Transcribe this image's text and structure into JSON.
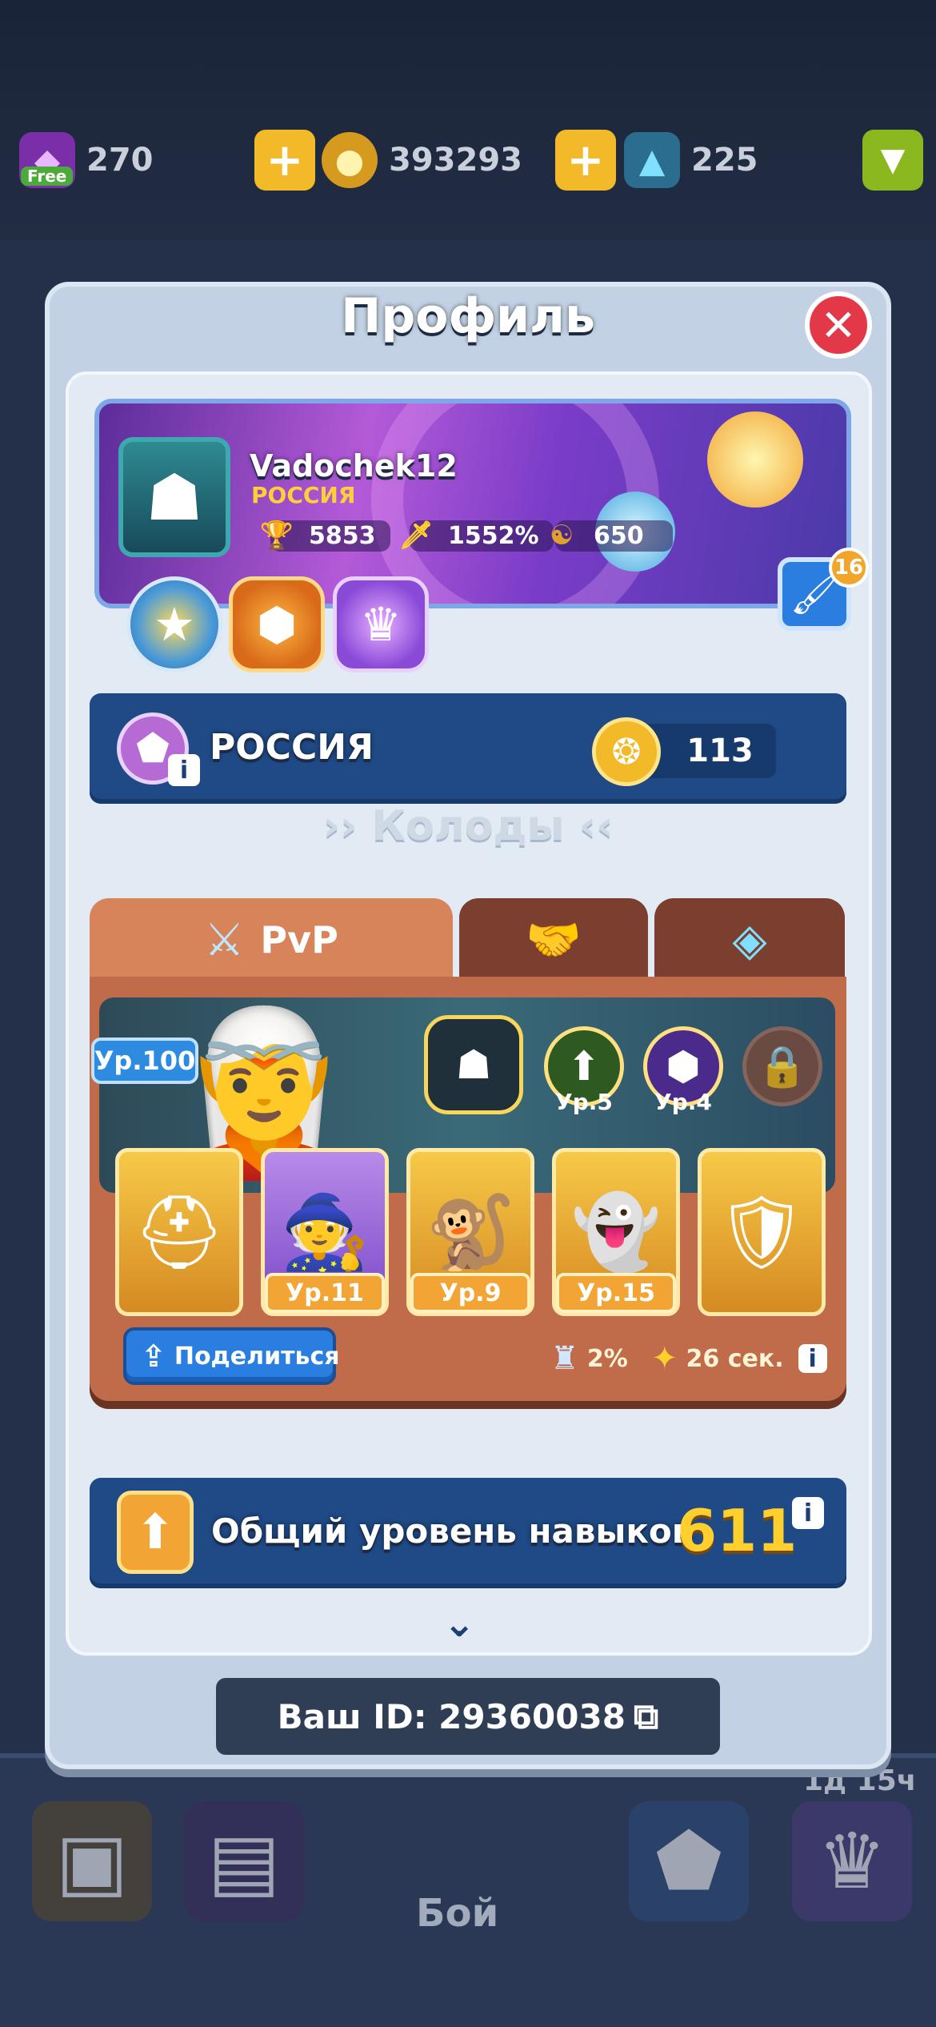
{
  "resources": {
    "gems": "270",
    "gems_tag": "Free",
    "coins": "393293",
    "crystals": "225"
  },
  "modal": {
    "title": "Профиль",
    "close_icon": "close-icon"
  },
  "player": {
    "name": "Vadochek12",
    "country": "РОССИЯ",
    "trophies": "5853",
    "crit": "1552%",
    "karma": "650",
    "customize_badge": "16"
  },
  "clan": {
    "name": "РОССИЯ",
    "score": "113"
  },
  "decks": {
    "title": "Колоды",
    "tabs": [
      {
        "label": "PvP",
        "icon": "swords-icon"
      },
      {
        "label": "",
        "icon": "handshake-icon"
      },
      {
        "label": "",
        "icon": "crystal-icon"
      }
    ],
    "hero_level": "Ур.100",
    "talents": [
      {
        "level": "Ур.5"
      },
      {
        "level": "Ур.4"
      }
    ],
    "cards": [
      {
        "name": "knight-card",
        "level": ""
      },
      {
        "name": "witch-card",
        "level": "Ур.11"
      },
      {
        "name": "monkey-card",
        "level": "Ур.9"
      },
      {
        "name": "spirit-card",
        "level": "Ур.15"
      },
      {
        "name": "paladin-card",
        "level": ""
      }
    ],
    "share_label": "Поделиться",
    "winrate": "2%",
    "time": "26 сек."
  },
  "skills": {
    "label": "Общий уровень навыков",
    "value": "611"
  },
  "player_id": {
    "label": "Ваш ID: 29360038"
  },
  "bottom_nav": {
    "battle_label": "Бой",
    "timer": "1д 15ч"
  },
  "colors": {
    "modal_bg": "#c2d2e4",
    "bar_blue": "#1f4a86",
    "deck_brown": "#c06b4a",
    "gold": "#ffcf2e",
    "close_red": "#e23848"
  }
}
